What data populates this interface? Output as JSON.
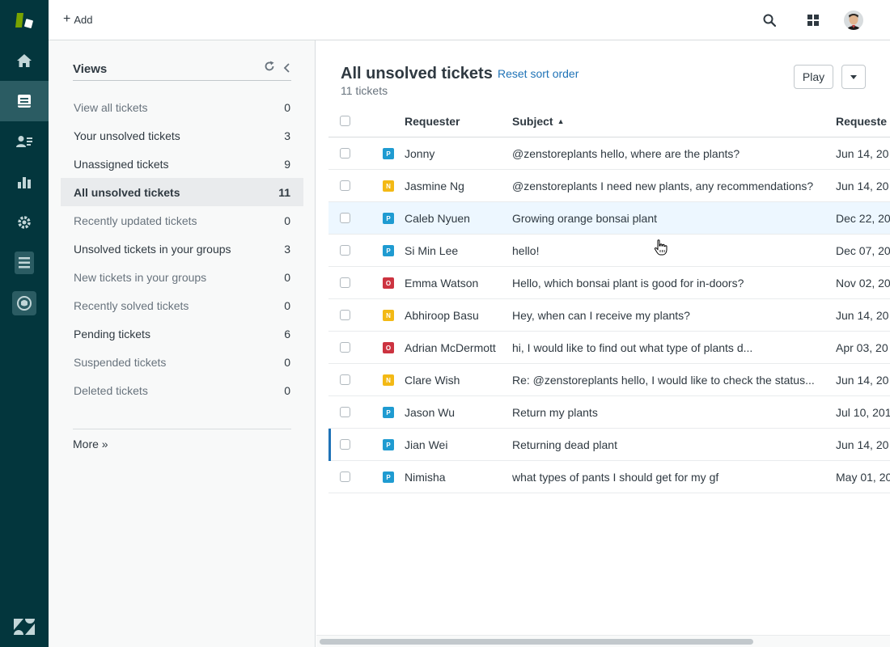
{
  "topbar": {
    "add_label": "Add",
    "icons": [
      "search-icon",
      "apps-grid-icon",
      "avatar"
    ]
  },
  "rail": {
    "items": [
      "home-icon",
      "views-icon",
      "customers-icon",
      "reporting-icon",
      "admin-icon",
      "sidebar-app-icon",
      "talk-icon"
    ],
    "active": "views-icon",
    "colors": {
      "background": "#03363d",
      "active": "#2b5c63",
      "logo_green": "#78a300"
    }
  },
  "views_panel": {
    "title": "Views",
    "items": [
      {
        "label": "View all tickets",
        "count": "0"
      },
      {
        "label": "Your unsolved tickets",
        "count": "3"
      },
      {
        "label": "Unassigned tickets",
        "count": "9"
      },
      {
        "label": "All unsolved tickets",
        "count": "11"
      },
      {
        "label": "Recently updated tickets",
        "count": "0"
      },
      {
        "label": "Unsolved tickets in your groups",
        "count": "3"
      },
      {
        "label": "New tickets in your groups",
        "count": "0"
      },
      {
        "label": "Recently solved tickets",
        "count": "0"
      },
      {
        "label": "Pending tickets",
        "count": "6"
      },
      {
        "label": "Suspended tickets",
        "count": "0"
      },
      {
        "label": "Deleted tickets",
        "count": "0"
      }
    ],
    "selected": "All unsolved tickets",
    "more_label": "More »"
  },
  "main": {
    "title": "All unsolved tickets",
    "reset_label": "Reset sort order",
    "ticket_count": "11 tickets",
    "play_label": "Play",
    "columns": {
      "requester": "Requester",
      "subject": "Subject",
      "requested": "Requeste",
      "sort_indicator": "▲"
    },
    "priority_colors": {
      "P": "#1f9bd1",
      "N": "#f3b915",
      "O": "#cc3340"
    },
    "rows": [
      {
        "status": "P",
        "requester": "Jonny",
        "subject": "@zenstoreplants hello, where are the plants?",
        "date": "Jun 14, 20"
      },
      {
        "status": "N",
        "requester": "Jasmine Ng",
        "subject": "@zenstoreplants I need new plants, any recommendations?",
        "date": "Jun 14, 20"
      },
      {
        "status": "P",
        "requester": "Caleb Nyuen",
        "subject": "Growing orange bonsai plant",
        "date": "Dec 22, 20"
      },
      {
        "status": "P",
        "requester": "Si Min Lee",
        "subject": "hello!",
        "date": "Dec 07, 20"
      },
      {
        "status": "O",
        "requester": "Emma Watson",
        "subject": "Hello, which bonsai plant is good for in-doors?",
        "date": "Nov 02, 20"
      },
      {
        "status": "N",
        "requester": "Abhiroop Basu",
        "subject": "Hey, when can I receive my plants?",
        "date": "Jun 14, 20"
      },
      {
        "status": "O",
        "requester": "Adrian McDermott",
        "subject": "hi, I would like to find out what type of plants d...",
        "date": "Apr 03, 20"
      },
      {
        "status": "N",
        "requester": "Clare Wish",
        "subject": "Re: @zenstoreplants hello, I would like to check the status...",
        "date": "Jun 14, 20"
      },
      {
        "status": "P",
        "requester": "Jason Wu",
        "subject": "Return my plants",
        "date": "Jul 10, 201"
      },
      {
        "status": "P",
        "requester": "Jian Wei",
        "subject": "Returning dead plant",
        "date": "Jun 14, 20"
      },
      {
        "status": "P",
        "requester": "Nimisha",
        "subject": "what types of pants I should get for my gf",
        "date": "May 01, 20"
      }
    ],
    "hovered_row": "Caleb Nyuen",
    "current_row": "Jian Wei"
  }
}
